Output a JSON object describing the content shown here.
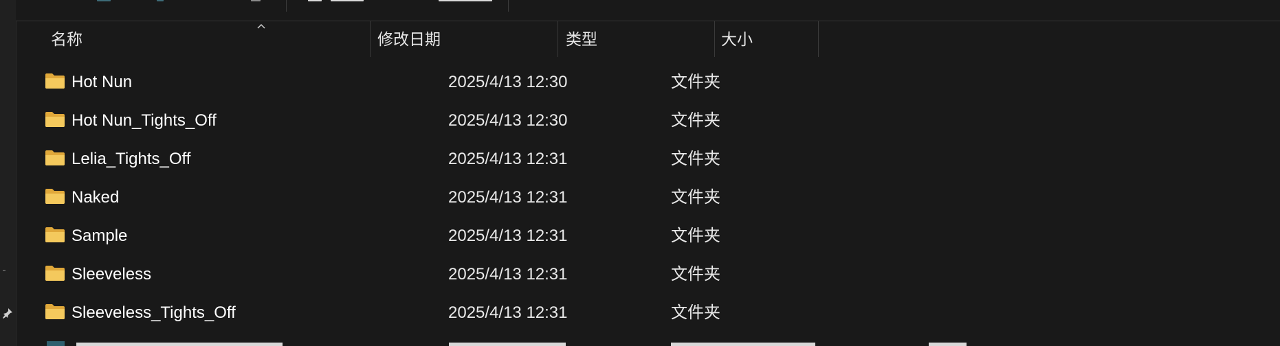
{
  "columns": {
    "name": "名称",
    "modified": "修改日期",
    "type": "类型",
    "size": "大小"
  },
  "files": [
    {
      "name": "Hot Nun",
      "modified": "2025/4/13 12:30",
      "type": "文件夹",
      "icon": "folder-icon"
    },
    {
      "name": "Hot Nun_Tights_Off",
      "modified": "2025/4/13 12:30",
      "type": "文件夹",
      "icon": "folder-icon"
    },
    {
      "name": "Lelia_Tights_Off",
      "modified": "2025/4/13 12:31",
      "type": "文件夹",
      "icon": "folder-icon"
    },
    {
      "name": "Naked",
      "modified": "2025/4/13 12:31",
      "type": "文件夹",
      "icon": "folder-icon"
    },
    {
      "name": "Sample",
      "modified": "2025/4/13 12:31",
      "type": "文件夹",
      "icon": "folder-icon"
    },
    {
      "name": "Sleeveless",
      "modified": "2025/4/13 12:31",
      "type": "文件夹",
      "icon": "folder-icon"
    },
    {
      "name": "Sleeveless_Tights_Off",
      "modified": "2025/4/13 12:31",
      "type": "文件夹",
      "icon": "folder-icon"
    }
  ],
  "sort": {
    "column": "name",
    "direction": "ascending",
    "icon": "sort-up-icon"
  },
  "colors": {
    "background": "#191919",
    "folder": "#f4c95d",
    "folder_dark": "#e0a83a",
    "text": "#ffffff"
  }
}
